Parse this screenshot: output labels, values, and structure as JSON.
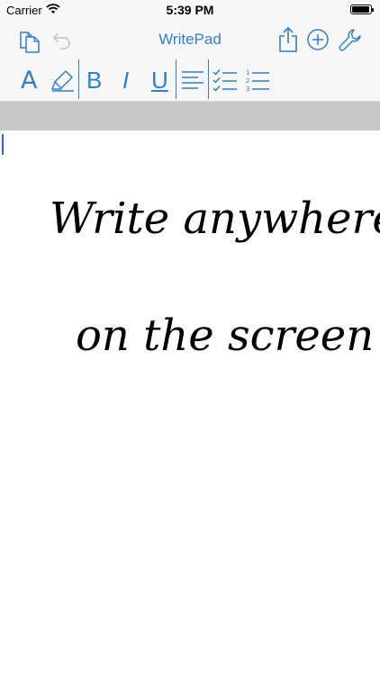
{
  "status": {
    "carrier": "Carrier",
    "time": "5:39 PM",
    "battery_level": 0.95
  },
  "nav": {
    "title": "WritePad",
    "undo_enabled": false
  },
  "format": {
    "font_label": "A",
    "bold_label": "B",
    "italic_label": "I",
    "underline_label": "U"
  },
  "document": {
    "lines": [
      "Write anywhere",
      "on the screen"
    ]
  },
  "colors": {
    "accent": "#2f7fd6",
    "cursor": "#3a5fd0",
    "strip": "#c8c8c8"
  }
}
